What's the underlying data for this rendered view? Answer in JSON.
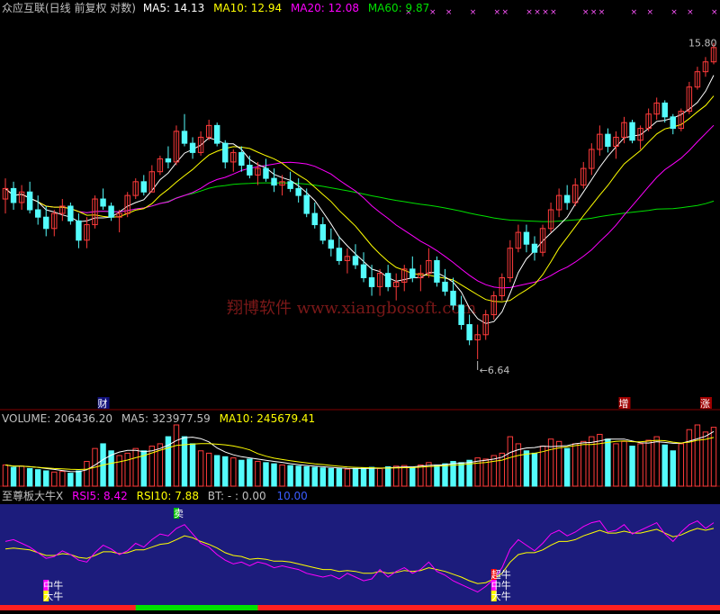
{
  "colors": {
    "up": "#ff3b3b",
    "down": "#54fcfc",
    "ma5": "#ffffff",
    "ma10": "#ffff00",
    "ma20": "#ff00ff",
    "ma60": "#00e000",
    "label": "#c0c0c0",
    "rsi_bg": "#1c1c7c",
    "rsi5": "#ff00ff",
    "rsi10": "#ffff00",
    "watermark": "#7a1818"
  },
  "price_header": {
    "title": "众应互联(日线 前复权 对数)",
    "ma5": "MA5: 14.13",
    "ma10": "MA10: 12.94",
    "ma20": "MA20: 12.08",
    "ma60": "MA60: 9.87"
  },
  "volume_header": {
    "label": "VOLUME: 206436.20",
    "ma5": "MA5: 323977.59",
    "ma10": "MA10: 245679.41"
  },
  "indicator_header": {
    "name": "至尊板大牛X",
    "rsi5": "RSI5: 8.42",
    "rsi10": "RSI10: 7.88",
    "bt": "BT: - : 0.00",
    "level": "10.00"
  },
  "watermark": "翔博软件 www.xiangbosoft.com",
  "price_labels": {
    "high": "15.80",
    "low": "6.64"
  },
  "event_markers": [
    "财",
    "增",
    "涨"
  ],
  "indicator_signals": [
    "卖",
    "中牛",
    "大牛",
    "中牛",
    "超牛",
    "中牛",
    "大牛"
  ],
  "chart_data": {
    "type": "candlestick",
    "candles": [
      [
        10.3,
        10.9,
        9.9,
        10.6
      ],
      [
        10.6,
        10.8,
        10.0,
        10.2
      ],
      [
        10.2,
        10.7,
        10.0,
        10.5
      ],
      [
        10.5,
        10.8,
        9.9,
        10.0
      ],
      [
        10.0,
        10.4,
        9.6,
        9.8
      ],
      [
        9.8,
        10.1,
        9.3,
        9.5
      ],
      [
        9.5,
        10.0,
        9.3,
        9.9
      ],
      [
        9.9,
        10.3,
        9.7,
        10.1
      ],
      [
        10.1,
        10.2,
        9.6,
        9.7
      ],
      [
        9.7,
        9.9,
        9.0,
        9.2
      ],
      [
        9.2,
        9.8,
        9.0,
        9.6
      ],
      [
        9.6,
        10.4,
        9.5,
        10.3
      ],
      [
        10.3,
        10.6,
        10.0,
        10.1
      ],
      [
        10.1,
        10.2,
        9.7,
        9.8
      ],
      [
        9.8,
        10.0,
        9.4,
        9.9
      ],
      [
        9.9,
        10.5,
        9.8,
        10.4
      ],
      [
        10.4,
        10.9,
        10.3,
        10.8
      ],
      [
        10.8,
        11.0,
        10.4,
        10.5
      ],
      [
        10.5,
        11.3,
        10.5,
        11.1
      ],
      [
        11.1,
        11.6,
        11.0,
        11.5
      ],
      [
        11.5,
        11.9,
        11.2,
        11.4
      ],
      [
        11.4,
        12.6,
        11.3,
        12.4
      ],
      [
        12.4,
        13.0,
        11.9,
        12.0
      ],
      [
        12.0,
        12.2,
        11.5,
        11.7
      ],
      [
        11.7,
        12.4,
        11.6,
        12.2
      ],
      [
        12.2,
        12.8,
        12.1,
        12.6
      ],
      [
        12.6,
        12.7,
        11.9,
        12.0
      ],
      [
        12.0,
        12.1,
        11.2,
        11.4
      ],
      [
        11.4,
        11.8,
        11.1,
        11.7
      ],
      [
        11.7,
        11.9,
        11.1,
        11.3
      ],
      [
        11.3,
        11.6,
        10.9,
        11.0
      ],
      [
        11.0,
        11.4,
        10.7,
        11.2
      ],
      [
        11.2,
        11.5,
        10.8,
        10.9
      ],
      [
        10.9,
        11.2,
        10.5,
        10.7
      ],
      [
        10.7,
        11.0,
        10.4,
        10.8
      ],
      [
        10.8,
        11.1,
        10.5,
        10.6
      ],
      [
        10.6,
        10.9,
        10.2,
        10.4
      ],
      [
        10.4,
        10.6,
        9.8,
        9.9
      ],
      [
        9.9,
        10.2,
        9.5,
        9.6
      ],
      [
        9.6,
        9.8,
        9.1,
        9.2
      ],
      [
        9.2,
        9.5,
        8.8,
        9.0
      ],
      [
        9.0,
        9.3,
        8.6,
        8.7
      ],
      [
        8.7,
        9.0,
        8.4,
        8.8
      ],
      [
        8.8,
        9.1,
        8.5,
        8.6
      ],
      [
        8.6,
        8.9,
        8.2,
        8.3
      ],
      [
        8.3,
        8.6,
        7.9,
        8.1
      ],
      [
        8.1,
        8.5,
        7.9,
        8.4
      ],
      [
        8.4,
        8.6,
        8.0,
        8.1
      ],
      [
        8.1,
        8.4,
        7.8,
        8.2
      ],
      [
        8.2,
        8.6,
        8.0,
        8.5
      ],
      [
        8.5,
        8.8,
        8.2,
        8.3
      ],
      [
        8.3,
        8.6,
        8.0,
        8.4
      ],
      [
        8.4,
        9.0,
        8.3,
        8.7
      ],
      [
        8.7,
        8.8,
        8.1,
        8.2
      ],
      [
        8.2,
        8.5,
        7.9,
        8.0
      ],
      [
        8.0,
        8.3,
        7.6,
        7.7
      ],
      [
        7.7,
        7.9,
        7.2,
        7.3
      ],
      [
        7.3,
        7.5,
        6.9,
        7.0
      ],
      [
        7.0,
        7.3,
        6.64,
        7.1
      ],
      [
        7.1,
        7.6,
        7.0,
        7.5
      ],
      [
        7.5,
        8.0,
        7.4,
        7.9
      ],
      [
        7.9,
        8.4,
        7.8,
        8.3
      ],
      [
        8.3,
        9.2,
        8.2,
        9.0
      ],
      [
        9.0,
        9.6,
        8.9,
        9.4
      ],
      [
        9.4,
        9.6,
        8.9,
        9.1
      ],
      [
        9.1,
        9.3,
        8.7,
        8.9
      ],
      [
        8.9,
        9.6,
        8.8,
        9.5
      ],
      [
        9.5,
        10.2,
        9.4,
        10.0
      ],
      [
        10.0,
        10.6,
        9.8,
        10.4
      ],
      [
        10.4,
        10.7,
        10.0,
        10.2
      ],
      [
        10.2,
        10.9,
        10.1,
        10.7
      ],
      [
        10.7,
        11.4,
        10.6,
        11.2
      ],
      [
        11.2,
        12.0,
        11.0,
        11.8
      ],
      [
        11.8,
        12.6,
        11.6,
        12.3
      ],
      [
        12.3,
        12.5,
        11.7,
        11.9
      ],
      [
        11.9,
        12.4,
        11.5,
        12.2
      ],
      [
        12.2,
        12.9,
        12.0,
        12.7
      ],
      [
        12.7,
        12.8,
        12.0,
        12.1
      ],
      [
        12.1,
        12.6,
        11.8,
        12.5
      ],
      [
        12.5,
        13.2,
        12.4,
        13.0
      ],
      [
        13.0,
        13.6,
        12.8,
        13.4
      ],
      [
        13.4,
        13.5,
        12.7,
        12.9
      ],
      [
        12.9,
        13.0,
        12.3,
        12.5
      ],
      [
        12.5,
        13.2,
        12.4,
        13.1
      ],
      [
        13.1,
        14.2,
        13.0,
        14.0
      ],
      [
        14.0,
        14.8,
        13.9,
        14.6
      ],
      [
        14.6,
        15.2,
        14.4,
        15.0
      ],
      [
        15.0,
        15.8,
        14.9,
        15.6
      ]
    ],
    "volume": [
      180000,
      160000,
      170000,
      150000,
      140000,
      130000,
      120000,
      125000,
      110000,
      130000,
      210000,
      320000,
      360000,
      300000,
      260000,
      280000,
      320000,
      300000,
      340000,
      360000,
      420000,
      520000,
      420000,
      360000,
      300000,
      280000,
      260000,
      250000,
      240000,
      220000,
      230000,
      210000,
      200000,
      190000,
      180000,
      175000,
      170000,
      165000,
      160000,
      155000,
      150000,
      148000,
      145000,
      150000,
      155000,
      160000,
      150000,
      165000,
      170000,
      175000,
      160000,
      180000,
      200000,
      180000,
      190000,
      210000,
      200000,
      220000,
      240000,
      230000,
      260000,
      280000,
      420000,
      360000,
      300000,
      280000,
      340000,
      400000,
      380000,
      320000,
      360000,
      380000,
      420000,
      440000,
      400000,
      360000,
      380000,
      340000,
      360000,
      390000,
      420000,
      350000,
      300000,
      360000,
      480000,
      520000,
      460000,
      500000
    ],
    "rsi5": [
      64,
      66,
      62,
      58,
      52,
      46,
      48,
      54,
      50,
      44,
      42,
      52,
      60,
      56,
      50,
      54,
      62,
      58,
      66,
      72,
      70,
      78,
      82,
      72,
      62,
      58,
      50,
      44,
      40,
      42,
      38,
      42,
      40,
      36,
      38,
      36,
      34,
      30,
      28,
      26,
      28,
      24,
      30,
      26,
      22,
      24,
      34,
      26,
      32,
      36,
      30,
      34,
      42,
      32,
      28,
      22,
      18,
      14,
      10,
      16,
      24,
      36,
      56,
      66,
      60,
      54,
      62,
      72,
      76,
      70,
      74,
      80,
      84,
      86,
      74,
      76,
      82,
      72,
      76,
      80,
      84,
      72,
      64,
      74,
      82,
      86,
      78,
      84
    ],
    "rsi10": [
      56,
      57,
      56,
      55,
      52,
      49,
      49,
      51,
      50,
      47,
      46,
      49,
      53,
      53,
      51,
      52,
      55,
      55,
      58,
      61,
      62,
      66,
      70,
      68,
      64,
      61,
      57,
      52,
      49,
      48,
      45,
      46,
      45,
      43,
      43,
      42,
      40,
      38,
      36,
      34,
      34,
      32,
      33,
      32,
      30,
      30,
      32,
      30,
      31,
      33,
      32,
      33,
      36,
      34,
      32,
      29,
      26,
      22,
      19,
      20,
      24,
      30,
      42,
      50,
      52,
      52,
      55,
      60,
      64,
      64,
      66,
      70,
      73,
      76,
      73,
      73,
      75,
      73,
      73,
      75,
      77,
      73,
      69,
      71,
      75,
      78,
      76,
      78
    ],
    "ylim": [
      6.0,
      17.0
    ],
    "log_scale": true,
    "rsi_ylim": [
      0,
      100
    ]
  }
}
